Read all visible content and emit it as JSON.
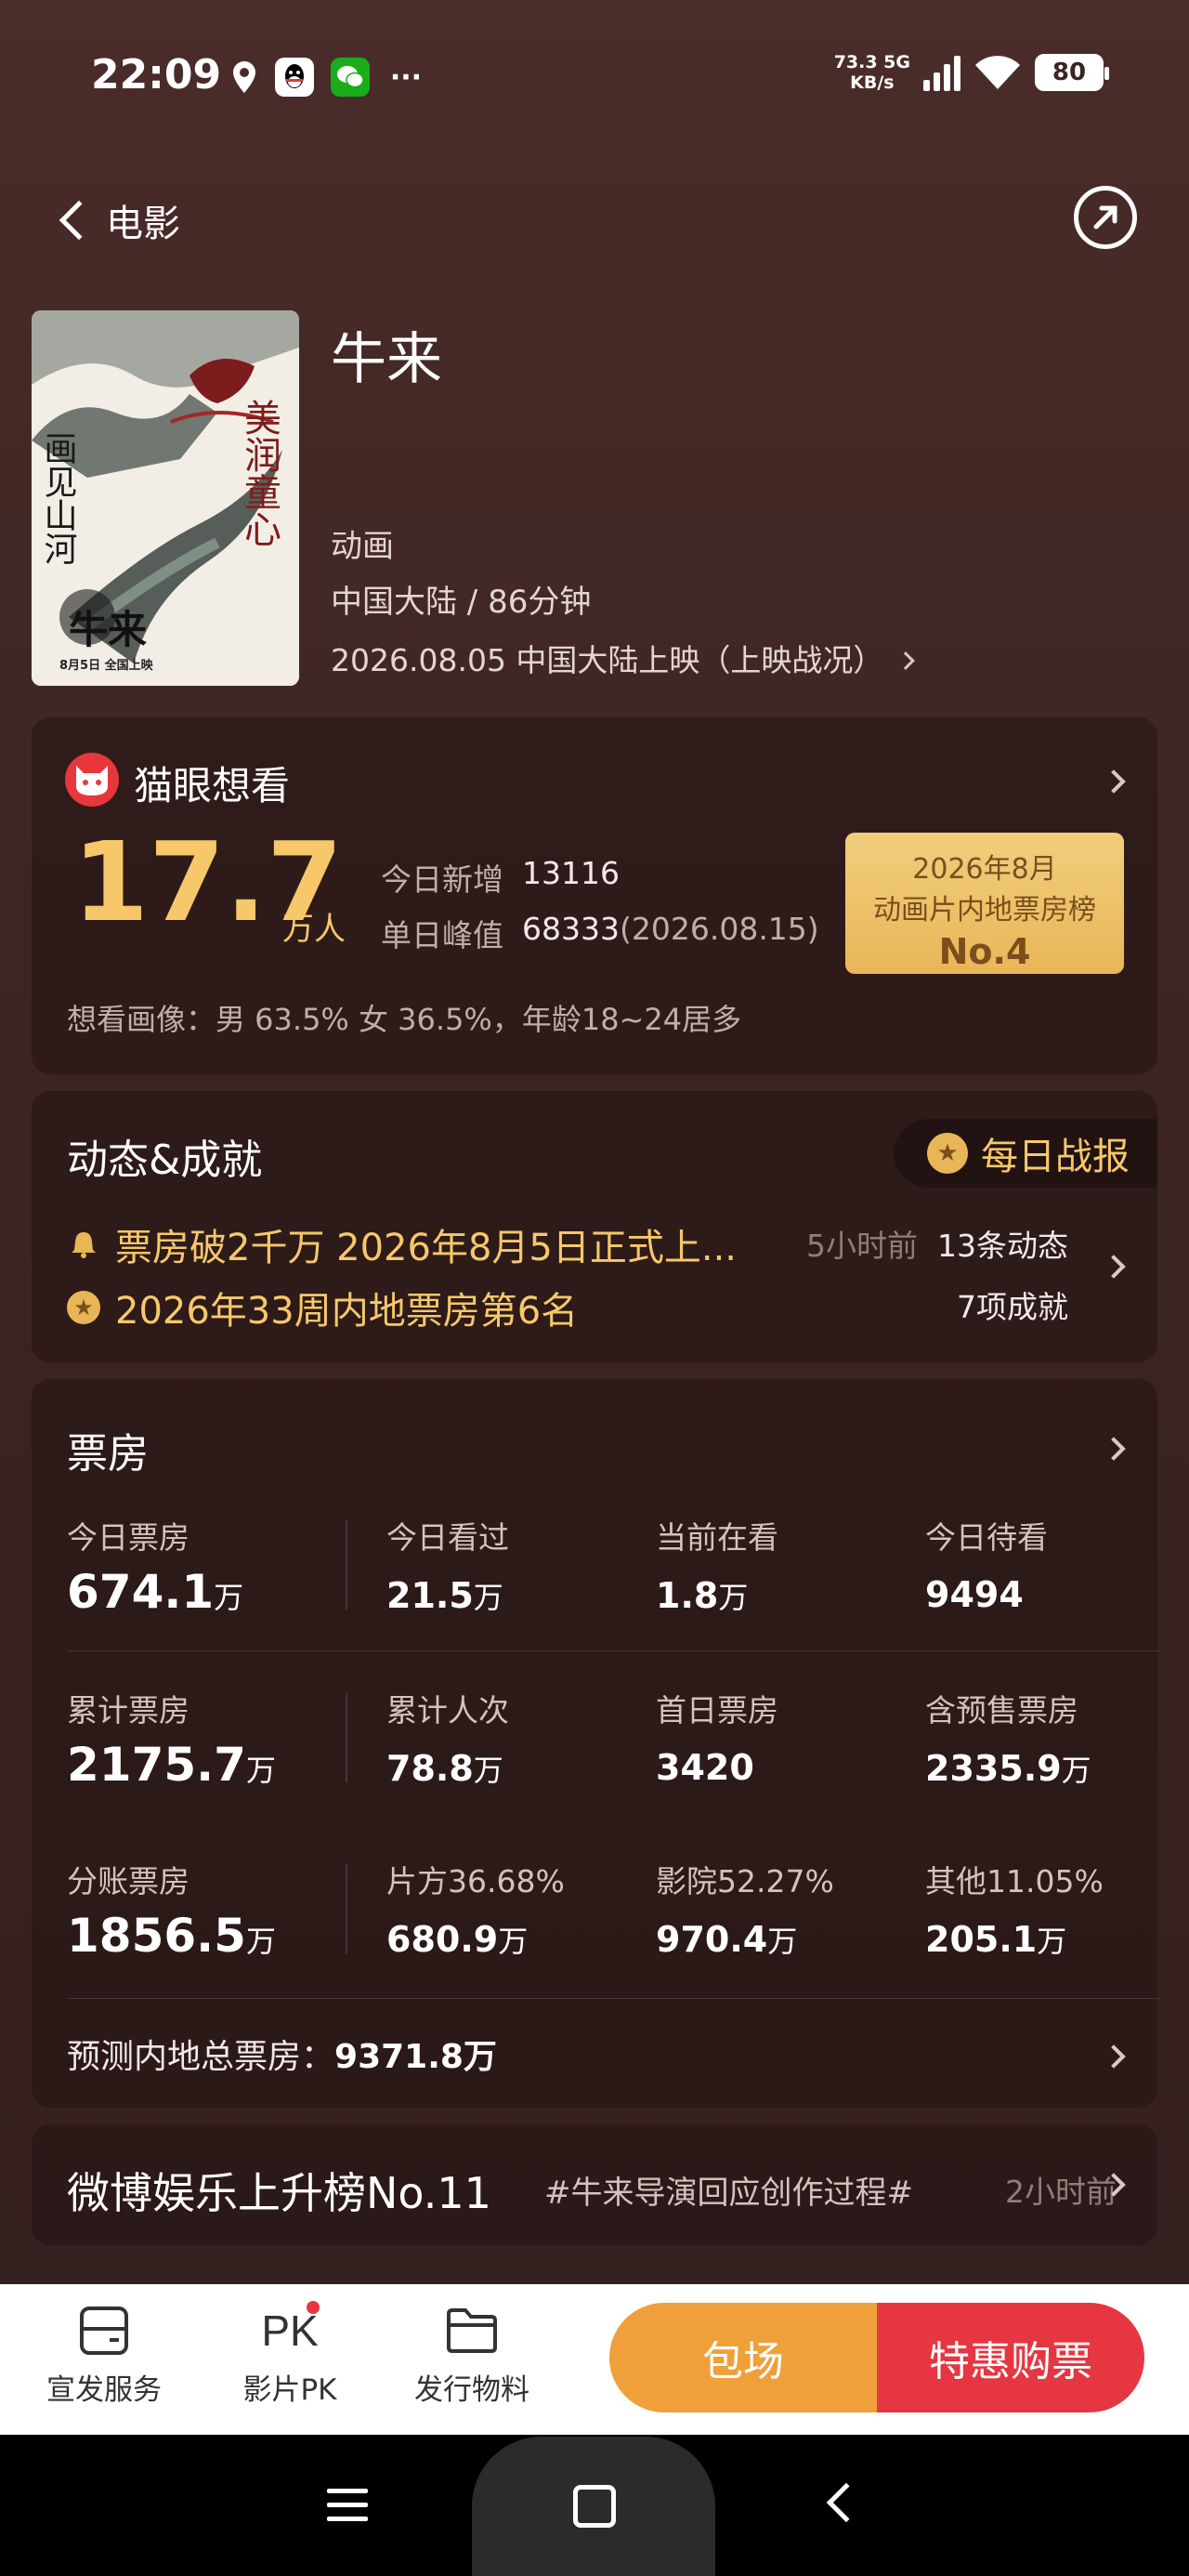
{
  "status_bar": {
    "time": "22:09",
    "net_speed_top": "73.3 5G",
    "net_speed_bottom": "KB/s",
    "battery": "80"
  },
  "nav": {
    "back_label": "电影"
  },
  "movie": {
    "title": "牛来",
    "genre": "动画",
    "meta": "中国大陆 / 86分钟",
    "release": "2026.08.05 中国大陆上映（上映战况）",
    "poster": {
      "left_text": "画见山河",
      "right_text": "美润童心",
      "name": "牛来",
      "date": "8月5日  全国上映"
    }
  },
  "want": {
    "title": "猫眼想看",
    "number": "17.7",
    "unit": "万人",
    "today_new_label": "今日新增",
    "today_new_value": "13116",
    "peak_label": "单日峰值",
    "peak_value": "68333",
    "peak_date": "(2026.08.15)",
    "rank_line1": "2026年8月",
    "rank_line2": "动画片内地票房榜",
    "rank_line3": "No.4",
    "portrait": "想看画像：男 63.5%  女 36.5%，年龄18~24居多"
  },
  "dynamics": {
    "title": "动态&成就",
    "daily_report": "每日战报",
    "item1": "票房破2千万 2026年8月5日正式上...",
    "item1_time": "5小时前",
    "item1_count": "13条动态",
    "item2": "2026年33周内地票房第6名",
    "item2_count": "7项成就"
  },
  "box_office": {
    "title": "票房",
    "rows": [
      [
        {
          "label": "今日票房",
          "value": "674.1",
          "unit": "万"
        },
        {
          "label": "今日看过",
          "value": "21.5",
          "unit": "万"
        },
        {
          "label": "当前在看",
          "value": "1.8",
          "unit": "万"
        },
        {
          "label": "今日待看",
          "value": "9494",
          "unit": ""
        }
      ],
      [
        {
          "label": "累计票房",
          "value": "2175.7",
          "unit": "万"
        },
        {
          "label": "累计人次",
          "value": "78.8",
          "unit": "万"
        },
        {
          "label": "首日票房",
          "value": "3420",
          "unit": ""
        },
        {
          "label": "含预售票房",
          "value": "2335.9",
          "unit": "万"
        }
      ],
      [
        {
          "label": "分账票房",
          "value": "1856.5",
          "unit": "万"
        },
        {
          "label": "片方36.68%",
          "value": "680.9",
          "unit": "万"
        },
        {
          "label": "影院52.27%",
          "value": "970.4",
          "unit": "万"
        },
        {
          "label": "其他11.05%",
          "value": "205.1",
          "unit": "万"
        }
      ]
    ],
    "forecast_label": "预测内地总票房：",
    "forecast_value": "9371.8万"
  },
  "weibo": {
    "title": "微博娱乐上升榜No.11",
    "tag": "#牛来导演回应创作过程#",
    "time": "2小时前"
  },
  "bottom_bar": {
    "tool1": "宣发服务",
    "tool2": "影片PK",
    "tool2_icon_text": "PK",
    "tool3": "发行物料",
    "booking": "包场",
    "buy": "特惠购票"
  }
}
